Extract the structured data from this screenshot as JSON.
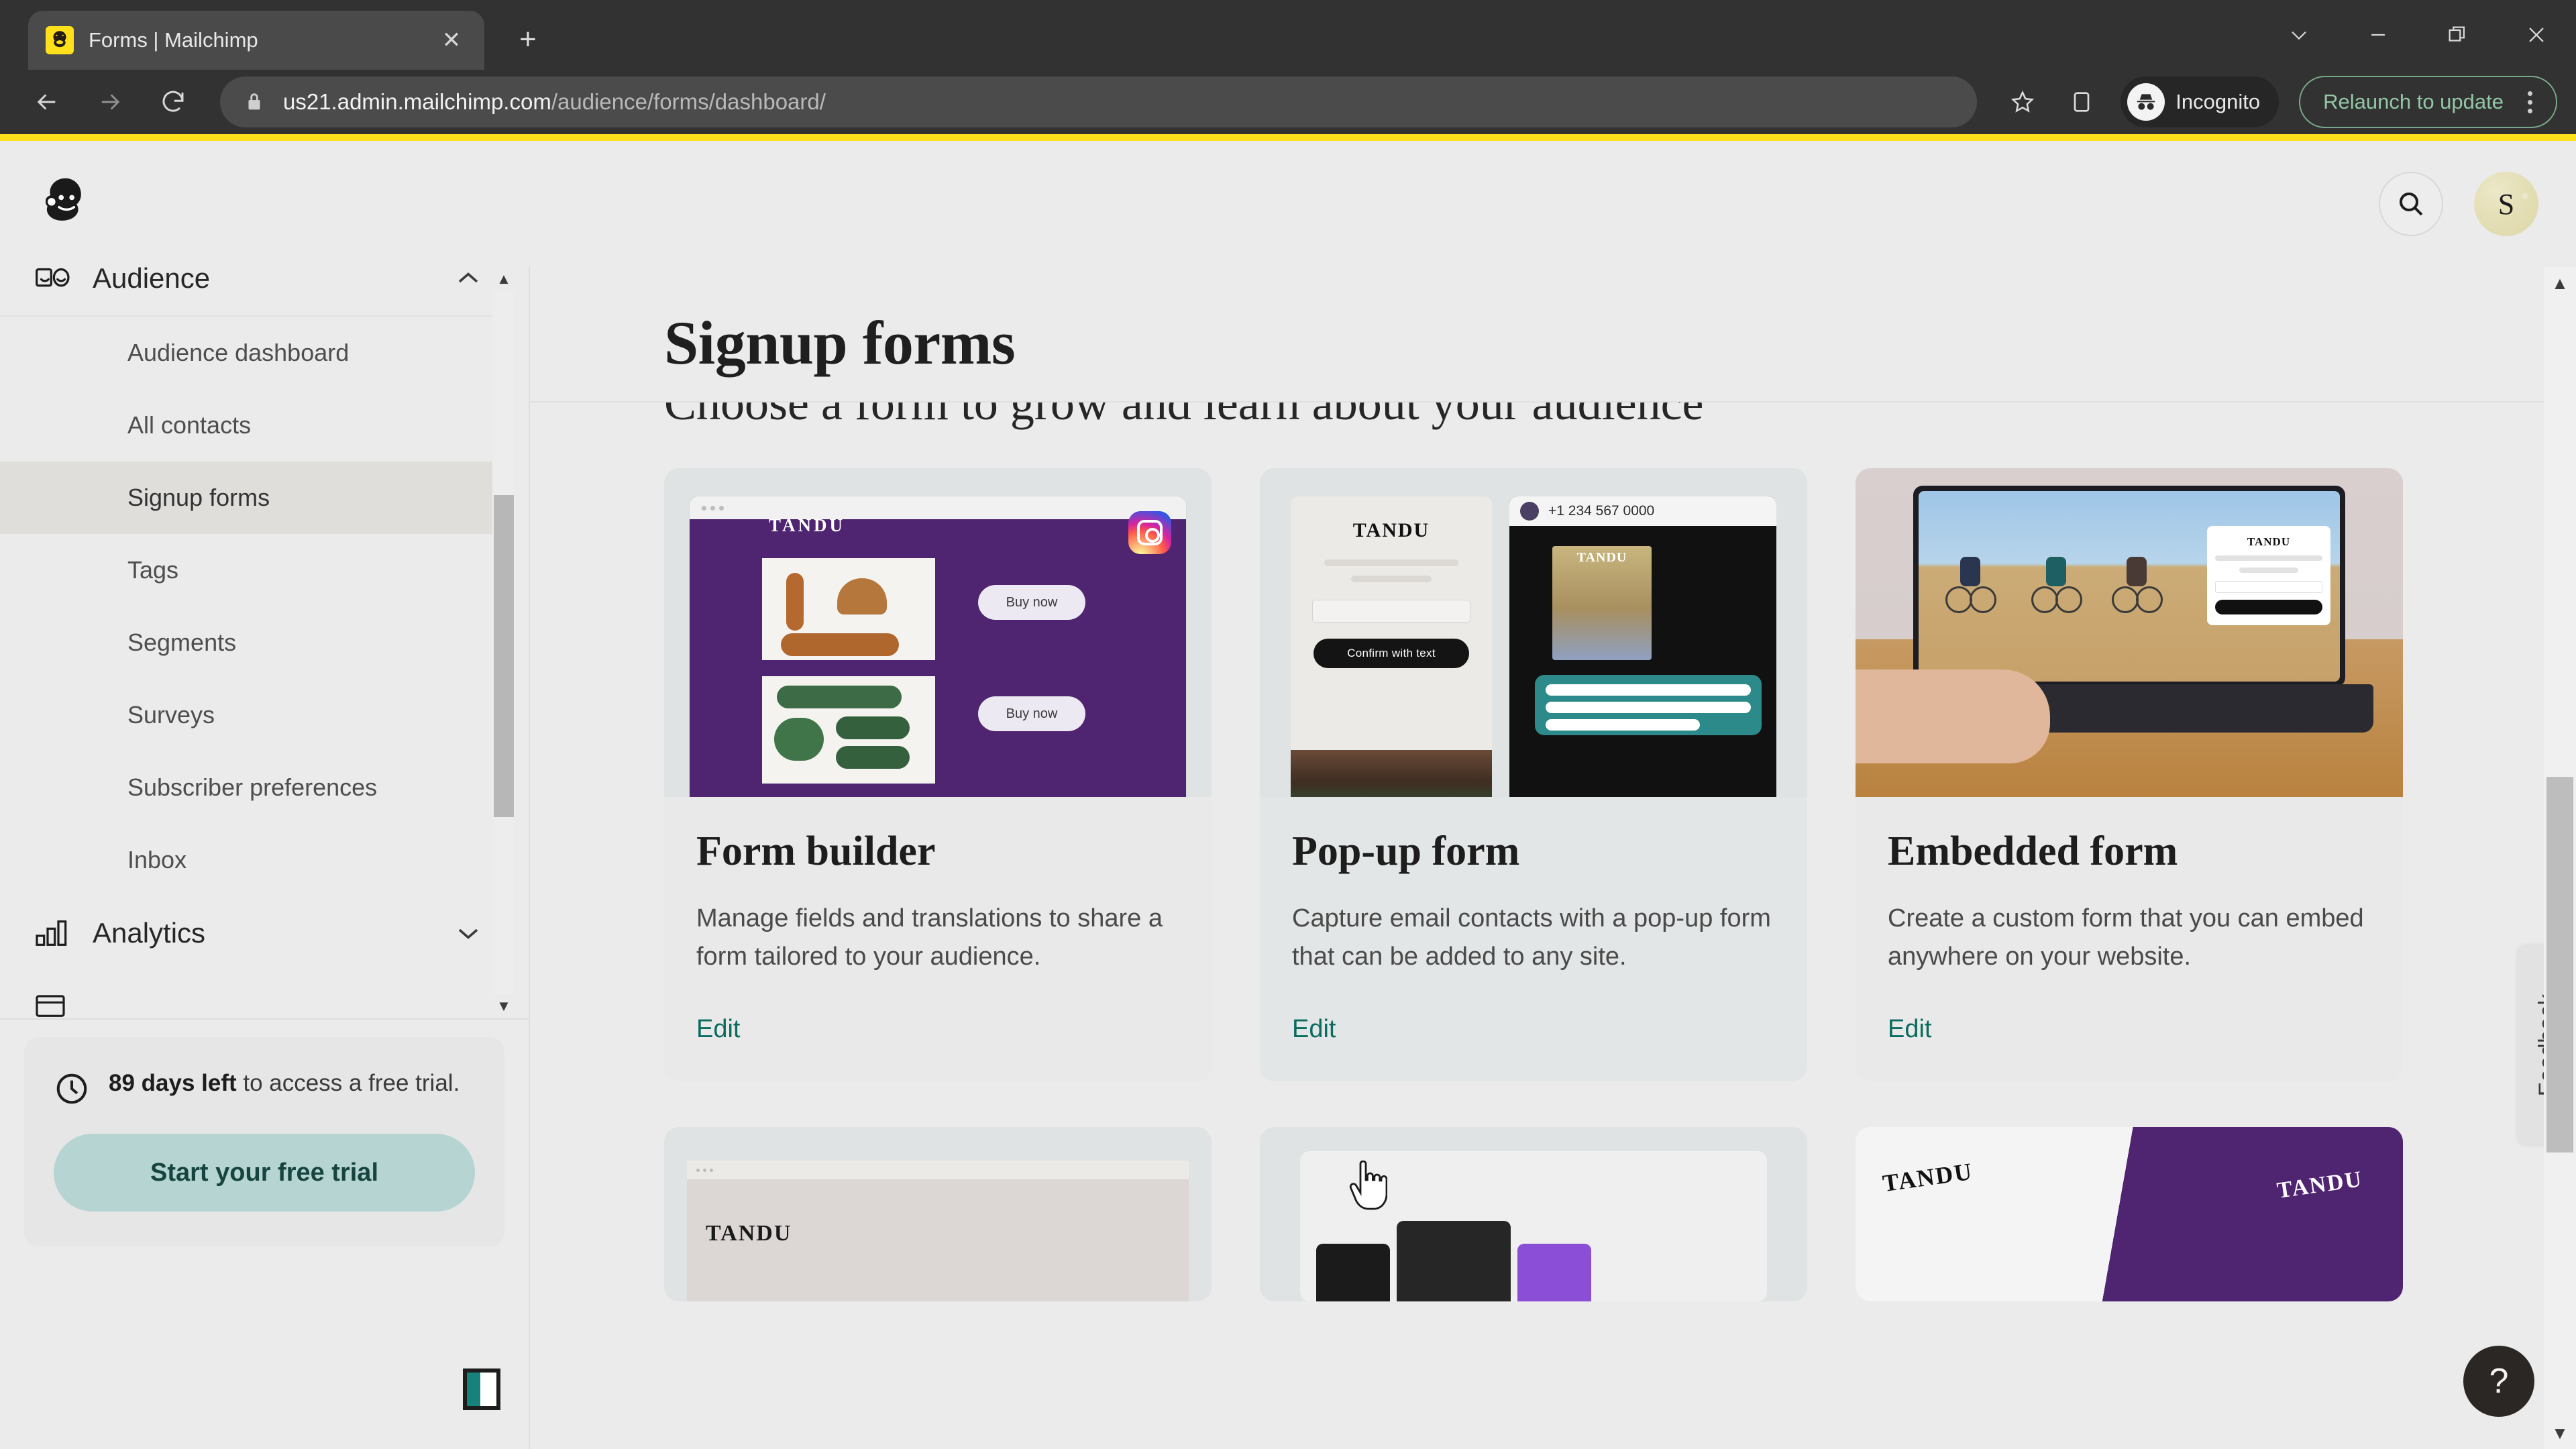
{
  "browser": {
    "tab": {
      "title": "Forms | Mailchimp",
      "favicon_icon": "mailchimp-favicon",
      "close_icon": "close-icon"
    },
    "new_tab_icon": "plus-icon",
    "window_controls": [
      "chevron-down-icon",
      "minimize-icon",
      "restore-icon",
      "close-icon"
    ],
    "nav": {
      "back_icon": "arrow-left-icon",
      "forward_icon": "arrow-right-icon",
      "reload_icon": "reload-icon"
    },
    "omnibox": {
      "lock_icon": "lock-icon",
      "url_host": "us21.admin.mailchimp.com",
      "url_path": "/audience/forms/dashboard/"
    },
    "bookmark_icon": "star-icon",
    "sidepanel_icon": "side-panel-icon",
    "incognito": {
      "label": "Incognito",
      "icon": "incognito-icon"
    },
    "update": {
      "label": "Relaunch to update",
      "menu_icon": "kebab-menu-icon"
    }
  },
  "app": {
    "accent_yellow": "#ffe01b",
    "logo_icon": "mailchimp-logo",
    "header": {
      "search_icon": "search-icon",
      "avatar_initial": "S"
    }
  },
  "sidebar": {
    "group": {
      "label": "Audience",
      "icon": "audience-icon",
      "chevron_icon": "chevron-up-icon"
    },
    "items": [
      {
        "label": "Audience dashboard",
        "active": false
      },
      {
        "label": "All contacts",
        "active": false
      },
      {
        "label": "Signup forms",
        "active": true
      },
      {
        "label": "Tags",
        "active": false
      },
      {
        "label": "Segments",
        "active": false
      },
      {
        "label": "Surveys",
        "active": false
      },
      {
        "label": "Subscriber preferences",
        "active": false
      },
      {
        "label": "Inbox",
        "active": false
      }
    ],
    "analytics": {
      "label": "Analytics",
      "icon": "bar-chart-icon",
      "chevron_icon": "chevron-down-icon"
    },
    "trial": {
      "icon": "clock-icon",
      "days_bold": "89 days left",
      "text_rest": " to access a free trial.",
      "button_label": "Start your free trial",
      "button_color": "#b6d4d2"
    },
    "panel_toggle_icon": "panel-toggle-icon"
  },
  "main": {
    "page_title": "Signup forms",
    "subtitle": "Choose a form to grow and learn about your audience",
    "edit_link_color": "#0a6b5f",
    "cards": [
      {
        "title": "Form builder",
        "description": "Manage fields and translations to share a form tailored to your audience.",
        "action": "Edit",
        "thumb": "form-builder-preview",
        "brand": "TANDU",
        "buy_label": "Buy now",
        "social_icon": "instagram-icon",
        "hovered": false
      },
      {
        "title": "Pop-up form",
        "description": "Capture email contacts with a pop-up form that can be added to any site.",
        "action": "Edit",
        "thumb": "popup-form-preview",
        "brand": "TANDU",
        "confirm_label": "Confirm with text",
        "phone_number": "+1 234 567 0000",
        "hovered": true
      },
      {
        "title": "Embedded form",
        "description": "Create a custom form that you can embed anywhere on your website.",
        "action": "Edit",
        "thumb": "embedded-form-preview",
        "brand": "TANDU",
        "hovered": false
      }
    ],
    "cards_row2": [
      {
        "thumb": "landing-page-preview",
        "brand": "TANDU"
      },
      {
        "thumb": "social-post-preview"
      },
      {
        "thumb": "qr-code-preview",
        "brand_left": "TANDU",
        "brand_right": "TANDU"
      }
    ]
  },
  "feedback": {
    "label": "Feedback"
  },
  "help": {
    "icon": "question-mark-icon",
    "label": "?"
  }
}
